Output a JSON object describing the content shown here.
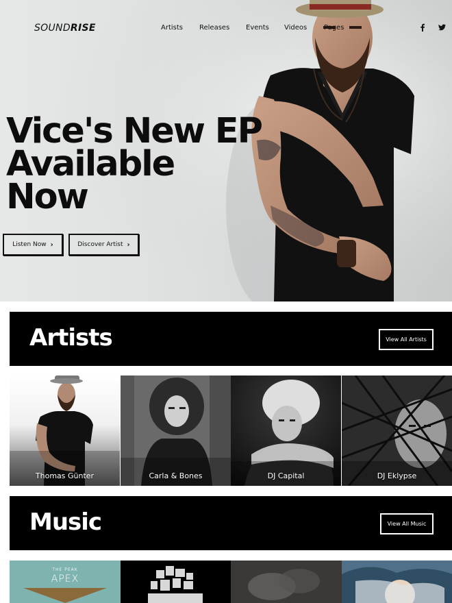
{
  "brand": {
    "logo_light": "SOUND",
    "logo_bold": "RISE"
  },
  "nav": {
    "items": [
      {
        "label": "Artists"
      },
      {
        "label": "Releases"
      },
      {
        "label": "Events"
      },
      {
        "label": "Videos"
      },
      {
        "label": "Pages"
      }
    ]
  },
  "social": {
    "icons": [
      "facebook-icon",
      "twitter-icon"
    ]
  },
  "hero": {
    "headline_lines": [
      "Vice's New EP",
      "Available",
      "Now"
    ],
    "primary_button": "Listen Now",
    "secondary_button": "Discover Artist",
    "button_chevron": "›"
  },
  "artists_section": {
    "title": "Artists",
    "view_all_label": "View All Artists",
    "cards": [
      {
        "name": "Thomas Günter"
      },
      {
        "name": "Carla & Bones"
      },
      {
        "name": "DJ Capital"
      },
      {
        "name": "DJ Eklypse"
      }
    ]
  },
  "music_section": {
    "title": "Music",
    "view_all_label": "View All Music",
    "tiles": [
      {
        "kicker": "THE PEAK",
        "title": "APEX"
      },
      {
        "kicker": "",
        "title": ""
      },
      {
        "kicker": "",
        "title": ""
      },
      {
        "kicker": "",
        "title": ""
      }
    ]
  },
  "colors": {
    "bar": "#000000",
    "hero_bg": "#e3e4e4",
    "text": "#111111",
    "tile_teal": "#7fb3b0"
  }
}
